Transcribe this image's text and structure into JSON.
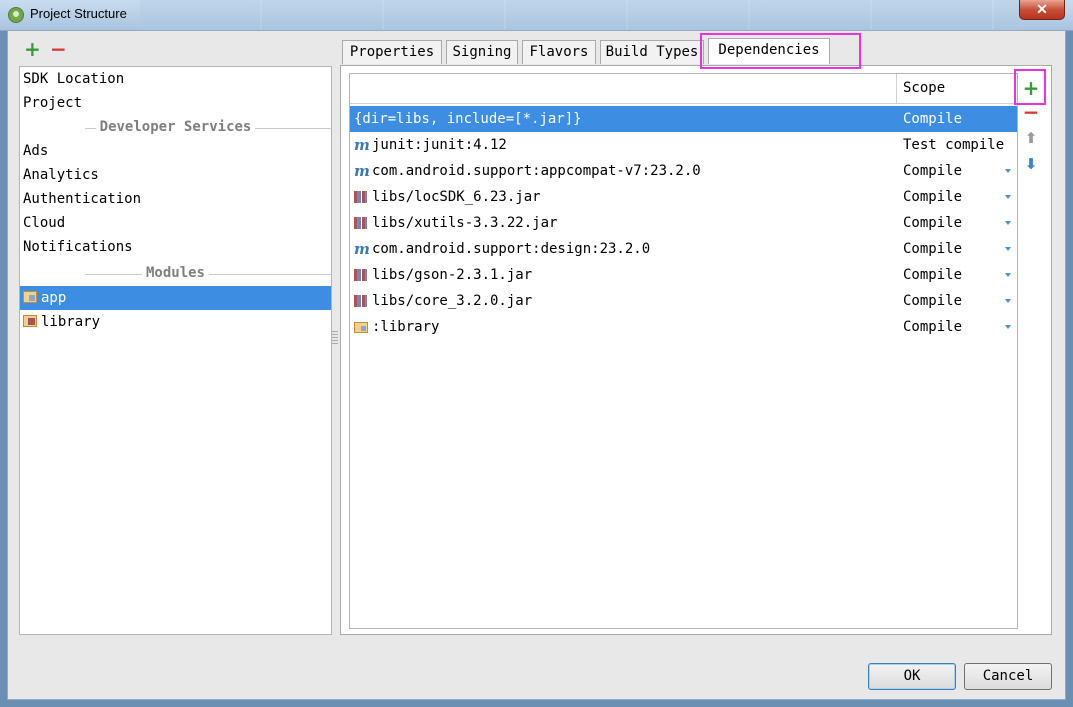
{
  "window": {
    "title": "Project Structure",
    "close_label": "✕"
  },
  "left_toolbar": {
    "add": "+",
    "remove": "−"
  },
  "sidebar": {
    "top_items": [
      "SDK Location",
      "Project"
    ],
    "developer_header": "Developer Services",
    "developer_items": [
      "Ads",
      "Analytics",
      "Authentication",
      "Cloud",
      "Notifications"
    ],
    "modules_header": "Modules",
    "modules": [
      {
        "label": "app",
        "selected": true,
        "icon": "module-icon"
      },
      {
        "label": "library",
        "selected": false,
        "icon": "library-module-icon"
      }
    ]
  },
  "tabs": [
    "Properties",
    "Signing",
    "Flavors",
    "Build Types",
    "Dependencies"
  ],
  "active_tab": "Dependencies",
  "dependencies": {
    "scope_header": "Scope",
    "rows": [
      {
        "name": "{dir=libs, include=[*.jar]}",
        "scope": "Compile",
        "icon": "none",
        "selected": true
      },
      {
        "name": "junit:junit:4.12",
        "scope": "Test compile",
        "icon": "maven-icon",
        "selected": false
      },
      {
        "name": "com.android.support:appcompat-v7:23.2.0",
        "scope": "Compile",
        "icon": "maven-icon",
        "selected": false
      },
      {
        "name": "libs/locSDK_6.23.jar",
        "scope": "Compile",
        "icon": "jar-icon",
        "selected": false
      },
      {
        "name": "libs/xutils-3.3.22.jar",
        "scope": "Compile",
        "icon": "jar-icon",
        "selected": false
      },
      {
        "name": "com.android.support:design:23.2.0",
        "scope": "Compile",
        "icon": "maven-icon",
        "selected": false
      },
      {
        "name": "libs/gson-2.3.1.jar",
        "scope": "Compile",
        "icon": "jar-icon",
        "selected": false
      },
      {
        "name": "libs/core_3.2.0.jar",
        "scope": "Compile",
        "icon": "jar-icon",
        "selected": false
      },
      {
        "name": ":library",
        "scope": "Compile",
        "icon": "module-icon",
        "selected": false
      }
    ]
  },
  "side_actions": {
    "add": "+",
    "remove": "−",
    "up": "⬆",
    "down": "⬇"
  },
  "buttons": {
    "ok": "OK",
    "cancel": "Cancel"
  },
  "colors": {
    "selection": "#3d8ee3",
    "highlight": "#e533e5",
    "add": "#3a9a3a",
    "remove": "#d23b3b"
  }
}
